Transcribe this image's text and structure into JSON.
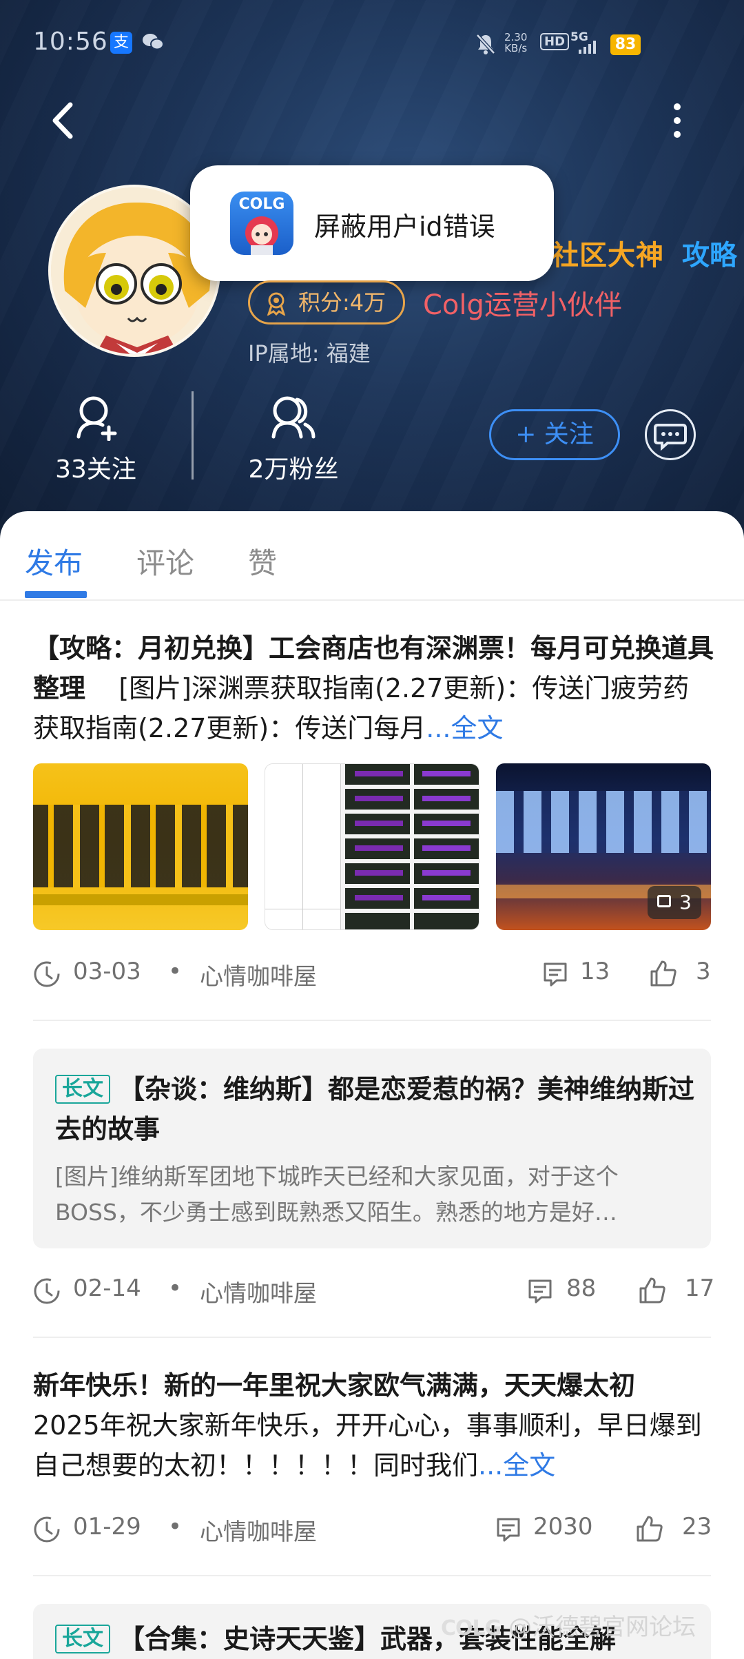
{
  "statusbar": {
    "time": "10:56",
    "net_speed": "2.30\nKB/s",
    "hd": "HD",
    "signal": "5G",
    "battery": "83"
  },
  "profile": {
    "badge_shen": "社区大神",
    "badge_gong": "攻略",
    "score": "积分:4万",
    "role": "Colg运营小伙伴",
    "ip": "IP属地: 福建",
    "following": "33关注",
    "fans": "2万粉丝",
    "follow_label": "+ 关注"
  },
  "toast": {
    "app": "COLG",
    "text": "屏蔽用户id错误"
  },
  "tabs": [
    {
      "label": "发布",
      "active": true
    },
    {
      "label": "评论",
      "active": false
    },
    {
      "label": "赞",
      "active": false
    }
  ],
  "posts": [
    {
      "title": "【攻略：月初兑换】工会商店也有深渊票！每月可兑换道具整理",
      "body": "[图片]深渊票获取指南(2.27更新)：传送门疲劳药获取指南(2.27更新)：传送门每月",
      "more": "...全文",
      "image_count": "3",
      "date": "03-03",
      "category": "心情咖啡屋",
      "comments": "13",
      "likes": "3"
    },
    {
      "tag": "长文",
      "title": "【杂谈：维纳斯】都是恋爱惹的祸？美神维纳斯过去的故事",
      "body": "[图片]维纳斯军团地下城昨天已经和大家见面，对于这个BOSS，不少勇士感到既熟悉又陌生。熟悉的地方是好…",
      "date": "02-14",
      "category": "心情咖啡屋",
      "comments": "88",
      "likes": "17"
    },
    {
      "title": "新年快乐！新的一年里祝大家欧气满满，天天爆太初",
      "body": "2025年祝大家新年快乐，开开心心，事事顺利，早日爆到自己想要的太初！！！！！！同时我们",
      "more": "...全文",
      "date": "01-29",
      "category": "心情咖啡屋",
      "comments": "2030",
      "likes": "23"
    },
    {
      "tag": "长文",
      "title": "【合集：史诗天天鉴】武器，套装性能全解"
    }
  ],
  "watermark": "@沃德碧官网论坛"
}
